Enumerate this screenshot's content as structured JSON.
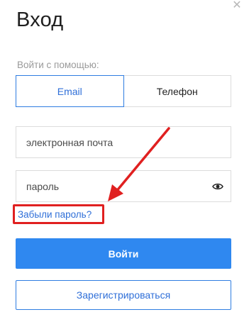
{
  "dialog": {
    "title": "Вход",
    "close_icon": "close-icon"
  },
  "login_method": {
    "hint": "Войти с помощью:",
    "tabs": [
      {
        "label": "Email",
        "active": true
      },
      {
        "label": "Телефон",
        "active": false
      }
    ]
  },
  "form": {
    "email_placeholder": "электронная почта",
    "password_placeholder": "пароль",
    "password_toggle_icon": "eye-icon",
    "forgot_password": "Забыли пароль?"
  },
  "actions": {
    "login_label": "Войти",
    "register_label": "Зарегистрироваться"
  },
  "annotation": {
    "color": "#e02020",
    "arrow_icon": "arrow-icon"
  },
  "colors": {
    "accent": "#2f88f0",
    "link": "#2f6fd8"
  }
}
